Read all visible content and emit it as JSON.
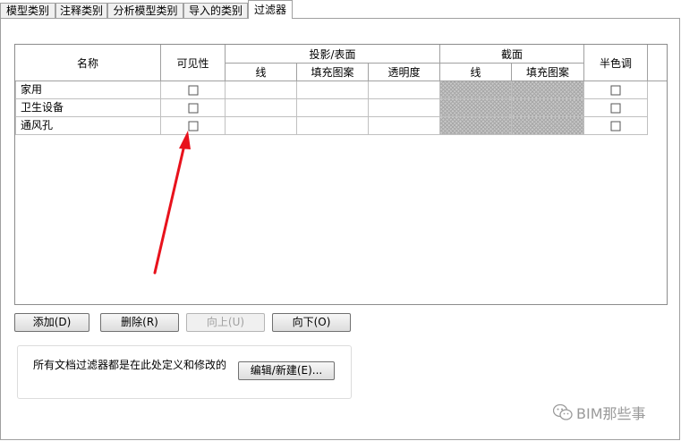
{
  "tabs": [
    {
      "label": "模型类别",
      "active": false
    },
    {
      "label": "注释类别",
      "active": false
    },
    {
      "label": "分析模型类别",
      "active": false
    },
    {
      "label": "导入的类别",
      "active": false
    },
    {
      "label": "过滤器",
      "active": true
    }
  ],
  "table": {
    "headers": {
      "name": "名称",
      "visibility": "可见性",
      "projection_surface": "投影/表面",
      "line": "线",
      "fill_pattern": "填充图案",
      "transparency": "透明度",
      "cut": "截面",
      "cut_line": "线",
      "cut_fill_pattern": "填充图案",
      "halftone": "半色调"
    },
    "rows": [
      {
        "name": "家用",
        "visible": false,
        "halftone": false
      },
      {
        "name": "卫生设备",
        "visible": false,
        "halftone": false
      },
      {
        "name": "通风孔",
        "visible": false,
        "halftone": false
      }
    ]
  },
  "buttons": {
    "add": "添加(D)",
    "delete": "删除(R)",
    "up": "向上(U)",
    "down": "向下(O)",
    "edit_new": "编辑/新建(E)..."
  },
  "description": "所有文档过滤器都是在此处定义和修改的",
  "watermark": "BIM那些事",
  "colors": {
    "annotation_arrow": "#e8121c"
  }
}
